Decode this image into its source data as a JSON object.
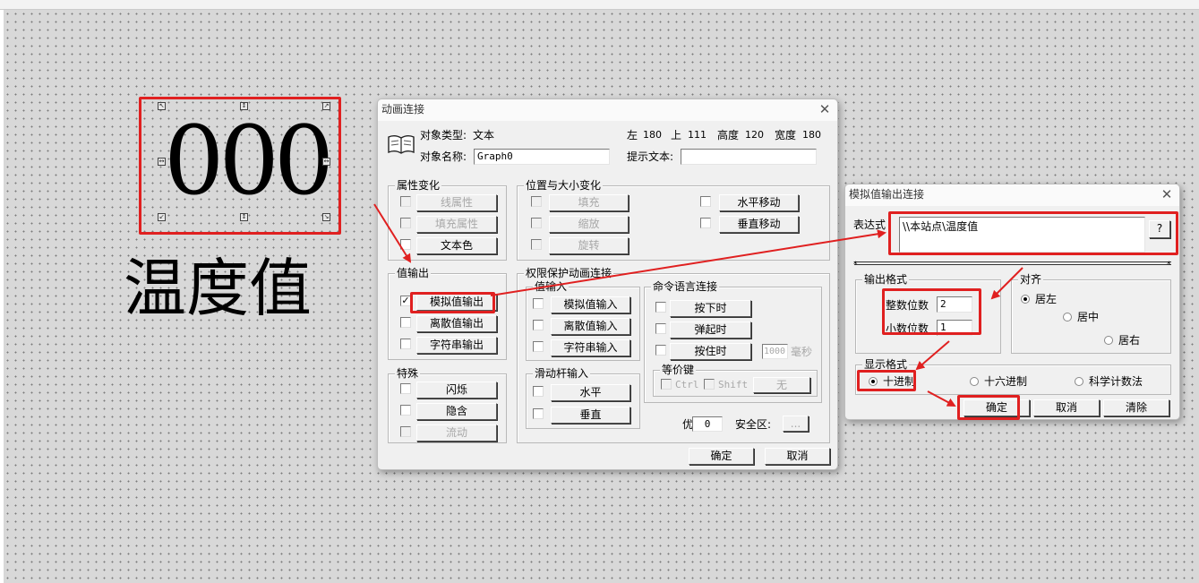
{
  "canvas": {
    "big_number": "000",
    "big_label": "温度值"
  },
  "main_dialog": {
    "title": "动画连接",
    "object_type_label": "对象类型:",
    "object_type_value": "文本",
    "object_name_label": "对象名称:",
    "object_name_value": "Graph0",
    "left_label": "左",
    "left_value": "180",
    "top_label": "上",
    "top_value": "111",
    "height_label": "高度",
    "height_value": "120",
    "width_label": "宽度",
    "width_value": "180",
    "hint_label": "提示文本:",
    "hint_value": "",
    "groups": {
      "attr_change": {
        "title": "属性变化",
        "items": [
          "线属性",
          "填充属性",
          "文本色"
        ]
      },
      "pos_size": {
        "title": "位置与大小变化",
        "items": [
          "填充",
          "缩放",
          "旋转"
        ],
        "items_right": [
          "水平移动",
          "垂直移动"
        ]
      },
      "value_output": {
        "title": "值输出",
        "items": [
          "模拟值输出",
          "离散值输出",
          "字符串输出"
        ]
      },
      "permission": {
        "title": "权限保护动画连接"
      },
      "value_input": {
        "title": "值输入",
        "items": [
          "模拟值输入",
          "离散值输入",
          "字符串输入"
        ]
      },
      "command": {
        "title": "命令语言连接",
        "items": [
          "按下时",
          "弹起时",
          "按住时"
        ],
        "hold_ms_value": "1000",
        "hold_ms_unit": "毫秒"
      },
      "hotkey": {
        "title": "等价键",
        "ctrl": "Ctrl",
        "shift": "Shift",
        "key_button": "无"
      },
      "special": {
        "title": "特殊",
        "items": [
          "闪烁",
          "隐含",
          "流动"
        ]
      },
      "slider": {
        "title": "滑动杆输入",
        "items": [
          "水平",
          "垂直"
        ]
      }
    },
    "priority_label": "优先级:",
    "priority_value": "0",
    "security_label": "安全区:",
    "security_button": "...",
    "ok": "确定",
    "cancel": "取消"
  },
  "analog_dialog": {
    "title": "模拟值输出连接",
    "expr_label": "表达式",
    "expr_value": "\\\\本站点\\温度值",
    "question_button": "?",
    "output_format_title": "输出格式",
    "int_digits_label": "整数位数",
    "int_digits_value": "2",
    "dec_digits_label": "小数位数",
    "dec_digits_value": "1",
    "align_title": "对齐",
    "align_left": "居左",
    "align_center": "居中",
    "align_right": "居右",
    "display_format_title": "显示格式",
    "fmt_decimal": "十进制",
    "fmt_hex": "十六进制",
    "fmt_sci": "科学计数法",
    "ok": "确定",
    "cancel": "取消",
    "clear": "清除"
  },
  "colors": {
    "highlight": "#e02020"
  }
}
